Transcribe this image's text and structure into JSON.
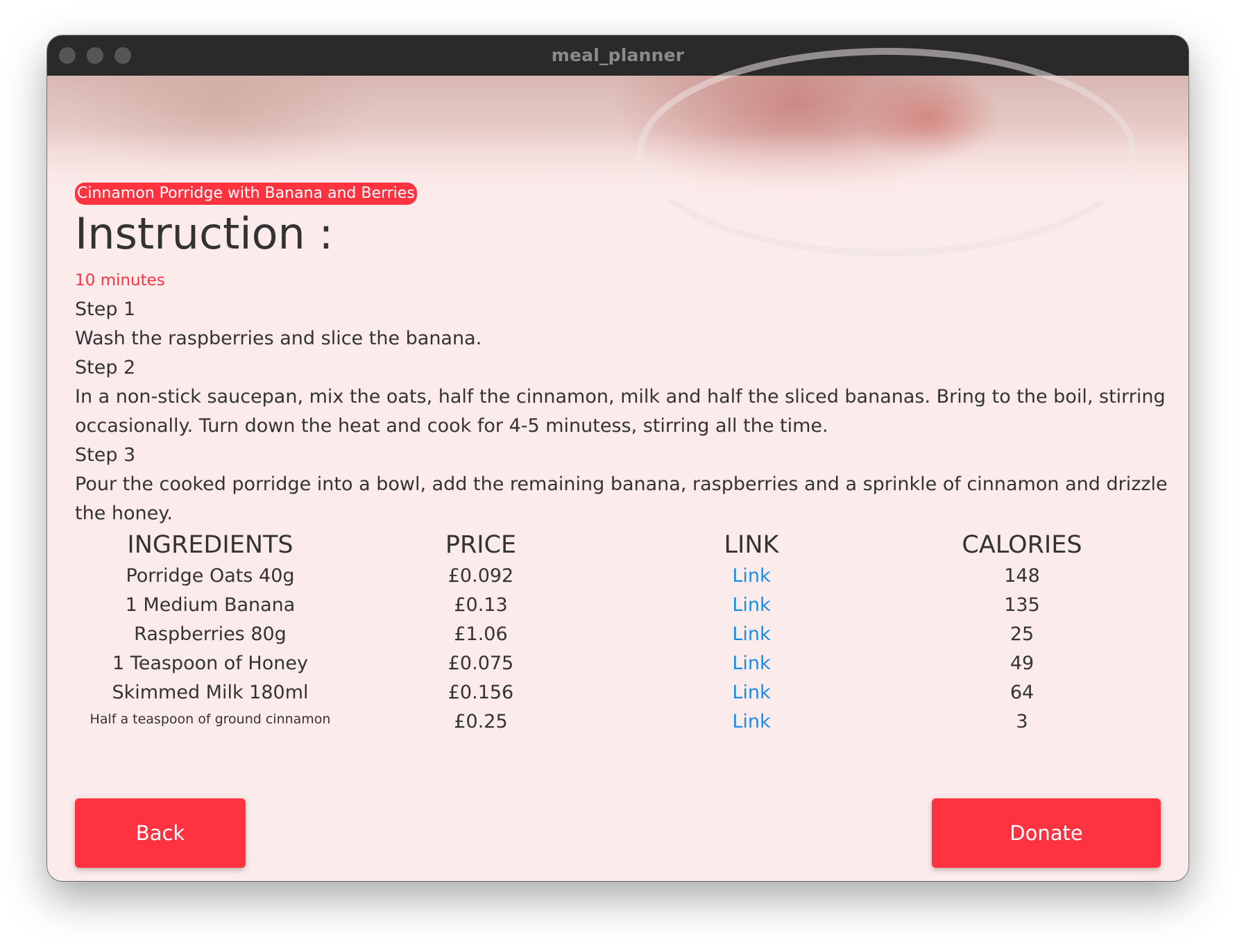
{
  "window": {
    "title": "meal_planner"
  },
  "recipe": {
    "name": "Cinnamon Porridge with Banana and Berries"
  },
  "instructions": {
    "heading": "Instruction :",
    "duration": "10 minutes",
    "steps": [
      {
        "title": "Step 1",
        "text": "Wash the raspberries and slice the banana."
      },
      {
        "title": "Step 2",
        "text": "In a non-stick saucepan, mix the oats, half the cinnamon, milk and half the sliced bananas. Bring to the boil, stirring occasionally. Turn down the heat and cook for 4-5 minutess, stirring all the time."
      },
      {
        "title": "Step 3",
        "text": "Pour the cooked porridge into a bowl, add the remaining banana, raspberries and a sprinkle of cinnamon and drizzle the honey."
      }
    ]
  },
  "table": {
    "headers": {
      "ingredients": "INGREDIENTS",
      "price": "PRICE",
      "link": "LINK",
      "calories": "CALORIES"
    },
    "rows": [
      {
        "ingredient": "Porridge Oats 40g",
        "price": "£0.092",
        "link": "Link",
        "calories": "148"
      },
      {
        "ingredient": "1 Medium Banana",
        "price": "£0.13",
        "link": "Link",
        "calories": "135"
      },
      {
        "ingredient": "Raspberries 80g",
        "price": "£1.06",
        "link": "Link",
        "calories": "25"
      },
      {
        "ingredient": "1 Teaspoon of Honey",
        "price": "£0.075",
        "link": "Link",
        "calories": "49"
      },
      {
        "ingredient": "Skimmed Milk 180ml",
        "price": "£0.156",
        "link": "Link",
        "calories": "64"
      },
      {
        "ingredient": "Half a teaspoon of ground cinnamon",
        "price": "£0.25",
        "link": "Link",
        "calories": "3"
      }
    ]
  },
  "buttons": {
    "back": "Back",
    "donate": "Donate"
  },
  "colors": {
    "accent": "#ff3340",
    "background": "#fcebeb",
    "link": "#1a8de8",
    "text": "#333333",
    "titlebar": "#2a2a2a"
  }
}
